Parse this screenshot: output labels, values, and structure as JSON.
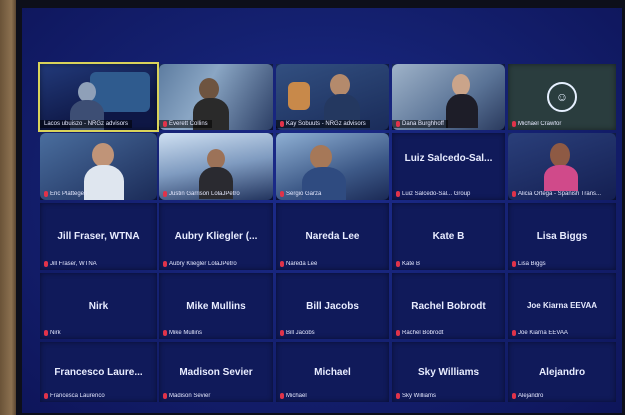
{
  "tiles": [
    {
      "name": "Lacos ubuiszo - NRGz advisors",
      "display": "",
      "video": true
    },
    {
      "name": "Everett Collins",
      "display": "",
      "video": true
    },
    {
      "name": "Kay Sobuuts - NRGz advisors",
      "display": "",
      "video": true
    },
    {
      "name": "Dana Burghhoff",
      "display": "",
      "video": true
    },
    {
      "name": "Michael Crawfor",
      "display": "",
      "video": true
    },
    {
      "name": "Eric Plattegen",
      "display": "",
      "video": true
    },
    {
      "name": "Justin Garrison LolaJPetro",
      "display": "",
      "video": true
    },
    {
      "name": "Sergio Garza",
      "display": "",
      "video": true
    },
    {
      "name": "Luiz Salcedo-Sal... Group",
      "display": "Luiz Salcedo-Sal...",
      "video": false
    },
    {
      "name": "Alicia Ortega - Spanish Trans...",
      "display": "",
      "video": true
    },
    {
      "name": "Jill Fraser, WTNA",
      "display": "Jill Fraser, WTNA",
      "video": false
    },
    {
      "name": "Aubry Kliegler LolaJPetro",
      "display": "Aubry Kliegler (...",
      "video": false
    },
    {
      "name": "Nareda Lee",
      "display": "Nareda Lee",
      "video": false
    },
    {
      "name": "Kate B",
      "display": "Kate B",
      "video": false
    },
    {
      "name": "Lisa Biggs",
      "display": "Lisa Biggs",
      "video": false
    },
    {
      "name": "Nirk",
      "display": "Nirk",
      "video": false
    },
    {
      "name": "Mike Mullins",
      "display": "Mike Mullins",
      "video": false
    },
    {
      "name": "Bill Jacobs",
      "display": "Bill Jacobs",
      "video": false
    },
    {
      "name": "Rachel Bobrodt",
      "display": "Rachel Bobrodt",
      "video": false
    },
    {
      "name": "Joe Kiarna EEVAA",
      "display": "Joe Kiarna EEVAA",
      "video": false
    },
    {
      "name": "Francesca Laurenco",
      "display": "Francesco Laure...",
      "video": false
    },
    {
      "name": "Madison Sevier",
      "display": "Madison Sevier",
      "video": false
    },
    {
      "name": "Michael",
      "display": "Michael",
      "video": false
    },
    {
      "name": "Sky Williams",
      "display": "Sky Williams",
      "video": false
    },
    {
      "name": "Alejandro",
      "display": "Alejandro",
      "video": false
    }
  ]
}
